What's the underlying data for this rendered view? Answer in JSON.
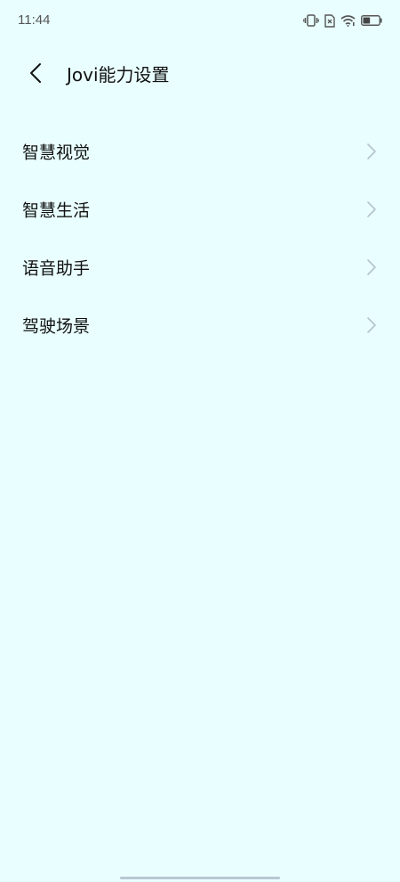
{
  "status_bar": {
    "time": "11:44",
    "icons": [
      "vibrate-icon",
      "no-sim-icon",
      "wifi-icon",
      "battery-icon"
    ],
    "battery_level": 0.45
  },
  "header": {
    "back_icon": "chevron-left-icon",
    "title": "Jovi能力设置"
  },
  "menu": {
    "items": [
      {
        "label": "智慧视觉"
      },
      {
        "label": "智慧生活"
      },
      {
        "label": "语音助手"
      },
      {
        "label": "驾驶场景"
      }
    ]
  },
  "colors": {
    "background": "#E9FEFE",
    "chevron": "#B4C3CD",
    "text": "#111111"
  }
}
